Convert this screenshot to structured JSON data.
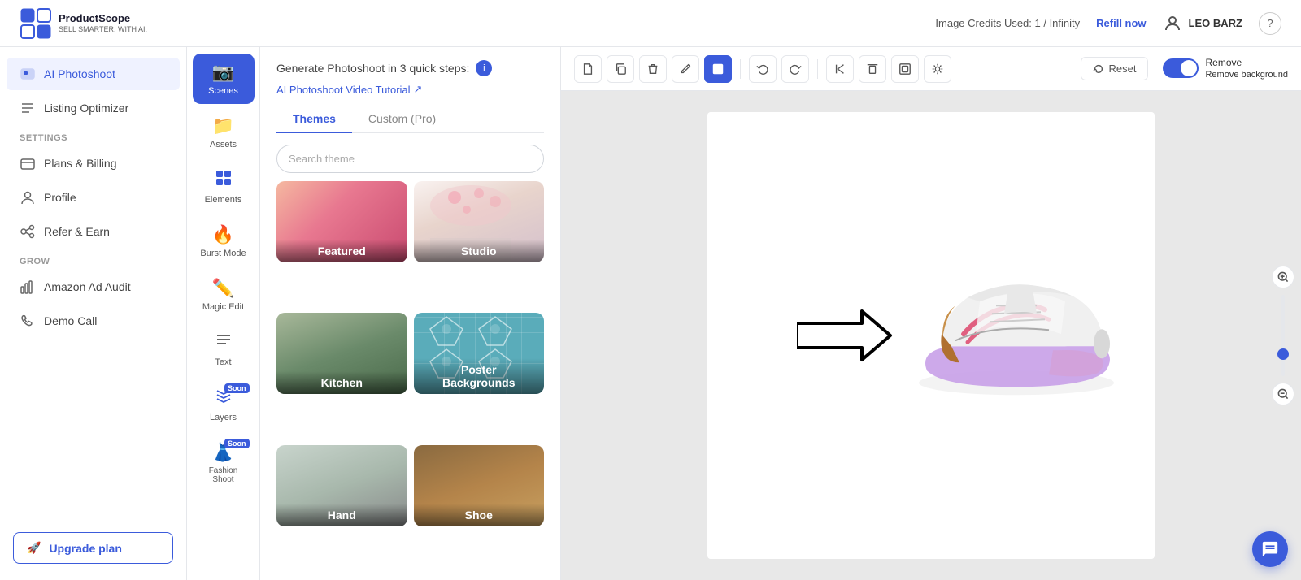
{
  "header": {
    "logo_text": "ProductScope",
    "logo_sub": "SELL SMARTER. WITH AI.",
    "credits_label": "Image Credits Used: 1 / Infinity",
    "refill_label": "Refill now",
    "user_name": "LEO BARZ"
  },
  "sidebar": {
    "items": [
      {
        "id": "ai-photoshoot",
        "label": "AI Photoshoot",
        "active": true
      },
      {
        "id": "listing-optimizer",
        "label": "Listing Optimizer",
        "active": false
      }
    ],
    "settings_label": "Settings",
    "settings_items": [
      {
        "id": "plans-billing",
        "label": "Plans & Billing"
      },
      {
        "id": "profile",
        "label": "Profile"
      },
      {
        "id": "refer-earn",
        "label": "Refer & Earn"
      }
    ],
    "grow_label": "Grow",
    "grow_items": [
      {
        "id": "amazon-ad-audit",
        "label": "Amazon Ad Audit"
      },
      {
        "id": "demo-call",
        "label": "Demo Call"
      }
    ],
    "upgrade_label": "Upgrade plan"
  },
  "tools": [
    {
      "id": "scenes",
      "label": "Scenes",
      "active": true,
      "icon": "📷",
      "soon": false
    },
    {
      "id": "assets",
      "label": "Assets",
      "active": false,
      "icon": "📁",
      "soon": false
    },
    {
      "id": "elements",
      "label": "Elements",
      "active": false,
      "icon": "⬛",
      "soon": false
    },
    {
      "id": "burst-mode",
      "label": "Burst Mode",
      "active": false,
      "icon": "🔥",
      "soon": false
    },
    {
      "id": "magic-edit",
      "label": "Magic Edit",
      "active": false,
      "icon": "✏️",
      "soon": false
    },
    {
      "id": "text",
      "label": "Text",
      "active": false,
      "icon": "☰",
      "soon": false
    },
    {
      "id": "layers",
      "label": "Layers",
      "active": false,
      "icon": "📄",
      "soon": true
    },
    {
      "id": "fashion-shoot",
      "label": "Fashion Shoot",
      "active": false,
      "icon": "👗",
      "soon": true
    }
  ],
  "middle": {
    "header_text": "Generate Photoshoot in 3 quick steps:",
    "video_link": "AI Photoshoot Video Tutorial",
    "tabs": [
      {
        "id": "themes",
        "label": "Themes",
        "active": true
      },
      {
        "id": "custom-pro",
        "label": "Custom (Pro)",
        "active": false
      }
    ],
    "search_placeholder": "Search theme",
    "themes": [
      {
        "id": "featured",
        "label": "Featured",
        "style": "featured"
      },
      {
        "id": "studio",
        "label": "Studio",
        "style": "studio"
      },
      {
        "id": "kitchen",
        "label": "Kitchen",
        "style": "kitchen"
      },
      {
        "id": "poster-backgrounds",
        "label": "Poster Backgrounds",
        "style": "poster"
      },
      {
        "id": "hand",
        "label": "Hand",
        "style": "hand"
      },
      {
        "id": "shoe",
        "label": "Shoe",
        "style": "shoe"
      }
    ]
  },
  "canvas": {
    "reset_label": "Reset",
    "remove_bg_label": "Remove background"
  }
}
